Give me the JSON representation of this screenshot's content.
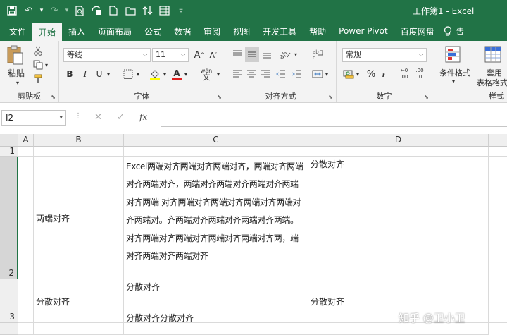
{
  "window": {
    "title": "工作簿1 - Excel"
  },
  "qat": {
    "save": "save-icon",
    "undo": "↶",
    "undo_dd": "▾",
    "redo": "↷",
    "redo_dd": "▾",
    "more": "▿"
  },
  "tabs": [
    "文件",
    "开始",
    "插入",
    "页面布局",
    "公式",
    "数据",
    "审阅",
    "视图",
    "开发工具",
    "帮助",
    "Power Pivot",
    "百度网盘"
  ],
  "tell_me": "吿",
  "ribbon": {
    "clipboard": {
      "paste": "粘贴",
      "label": "剪贴板"
    },
    "font": {
      "name": "等线",
      "size": "11",
      "grow": "A",
      "shrink": "A",
      "bold": "B",
      "italic": "I",
      "underline": "U",
      "phonetic": "wén",
      "color_a": "A",
      "label": "字体"
    },
    "alignment": {
      "label": "对齐方式"
    },
    "number": {
      "format": "常规",
      "percent": "%",
      "comma": ",",
      "inc": ".00",
      "dec": ".0",
      "label": "数字"
    },
    "styles": {
      "conditional": "条件格式",
      "table": "套用",
      "table2": "表格格式",
      "label": "样式"
    }
  },
  "formula_bar": {
    "name_box": "I2",
    "fx": "fx",
    "cancel": "✕",
    "confirm": "✓",
    "content": ""
  },
  "columns": [
    "A",
    "B",
    "C",
    "D"
  ],
  "rows": [
    "1",
    "2",
    "3"
  ],
  "cells": {
    "B2": "两端对齐",
    "C2": "Excel两端对齐两端对齐两端对齐，两端对齐两端对齐两端对齐，两端对齐两端对齐两端对齐两端对齐两端 对齐两端对齐两端对齐两端对齐两端对齐两端对。齐两端对齐两端对齐两端对齐两端。对齐两端对齐两端对齐两端对齐两端对齐两，端对齐两端对齐两端对齐",
    "D2": "分散对齐",
    "B3": "分散对齐",
    "C3_line1": "分散对齐",
    "C3_line2": "分散对齐分散对齐",
    "D3": "分散对齐"
  },
  "watermark": "知乎 @卫小卫",
  "colors": {
    "accent": "#217346",
    "ribbon_bg": "#f3f3f3"
  }
}
